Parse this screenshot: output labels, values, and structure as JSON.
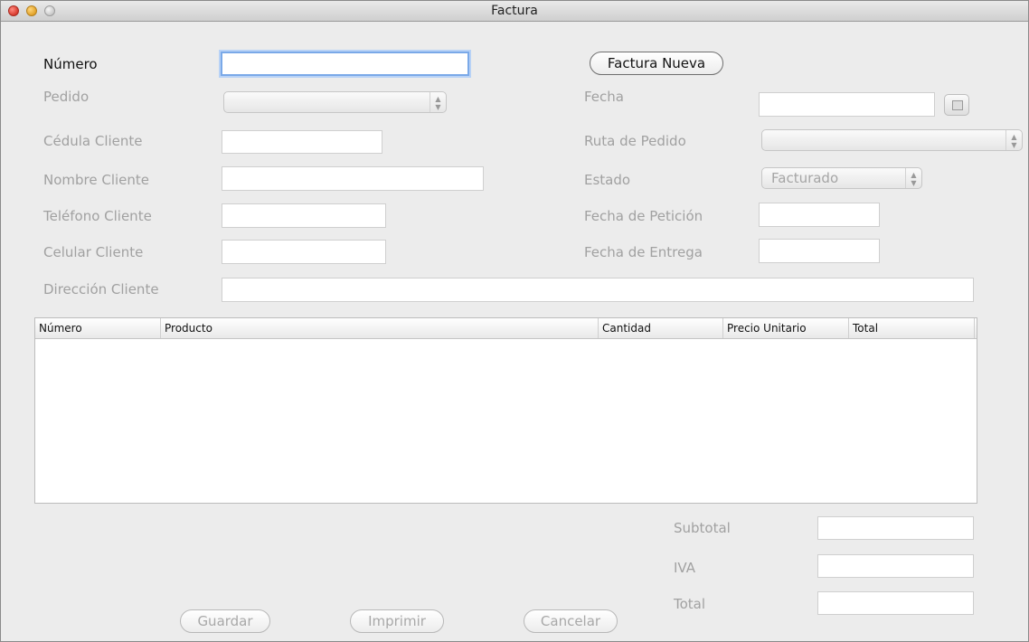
{
  "window": {
    "title": "Factura"
  },
  "form": {
    "numero_label": "Número",
    "nueva_button": "Factura Nueva",
    "pedido_label": "Pedido",
    "pedido_value": "",
    "fecha_label": "Fecha",
    "cedula_label": "Cédula Cliente",
    "ruta_label": "Ruta de Pedido",
    "ruta_value": "",
    "nombre_label": "Nombre Cliente",
    "estado_label": "Estado",
    "estado_value": "Facturado",
    "telefono_label": "Teléfono Cliente",
    "fecha_peticion_label": "Fecha de Petición",
    "celular_label": "Celular Cliente",
    "fecha_entrega_label": "Fecha de Entrega",
    "direccion_label": "Dirección Cliente"
  },
  "table": {
    "columns": [
      "Número",
      "Producto",
      "Cantidad",
      "Precio Unitario",
      "Total"
    ],
    "rows": []
  },
  "totals": {
    "subtotal_label": "Subtotal",
    "iva_label": "IVA",
    "total_label": "Total"
  },
  "actions": {
    "guardar": "Guardar",
    "imprimir": "Imprimir",
    "cancelar": "Cancelar"
  },
  "icons": {
    "calendar": "calendar-icon",
    "close": "close-icon",
    "minimize": "minimize-icon",
    "zoom": "zoom-icon",
    "stepper": "up-down-arrows-icon"
  }
}
